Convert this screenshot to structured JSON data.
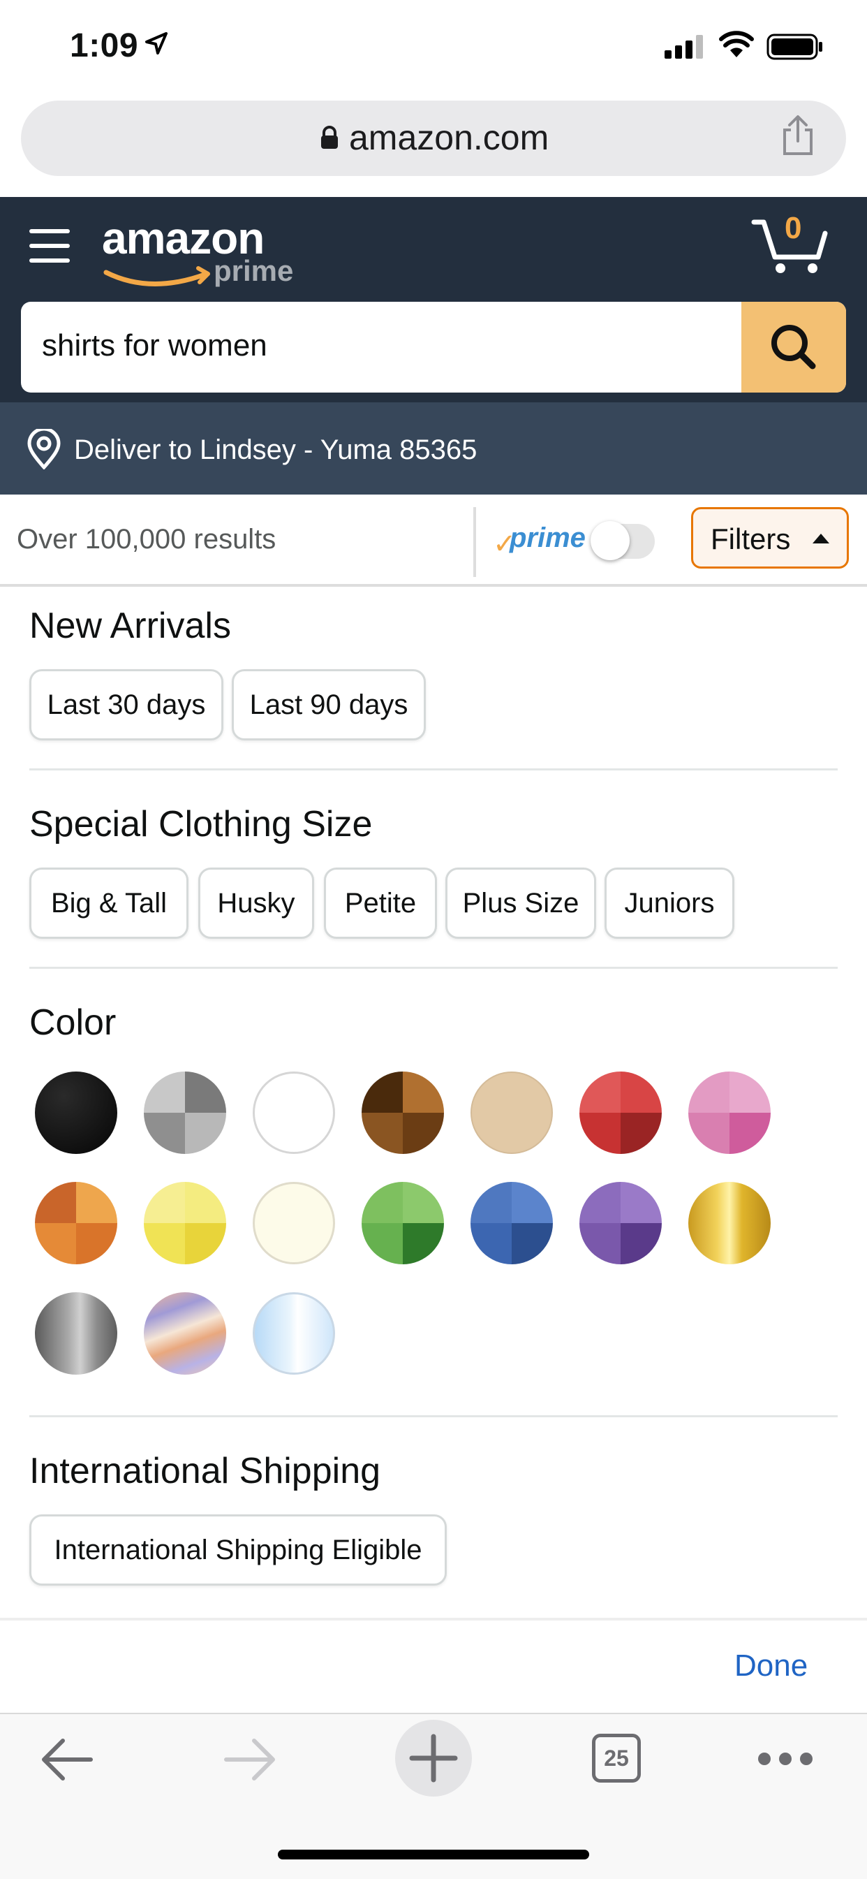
{
  "status_bar": {
    "time": "1:09"
  },
  "browser": {
    "url": "amazon.com",
    "tab_count": "25"
  },
  "header": {
    "logo_text": "amazon",
    "logo_sub": "prime",
    "cart_count": "0",
    "search_value": "shirts for women",
    "deliver_text": "Deliver to Lindsey - Yuma 85365"
  },
  "results_bar": {
    "results_text": "Over 100,000 results",
    "prime_label": "prime",
    "prime_toggle_on": false,
    "filters_label": "Filters"
  },
  "sections": {
    "new_arrivals": {
      "title": "New Arrivals",
      "options": [
        "Last 30 days",
        "Last 90 days"
      ]
    },
    "special_size": {
      "title": "Special Clothing Size",
      "options": [
        "Big & Tall",
        "Husky",
        "Petite",
        "Plus Size",
        "Juniors"
      ]
    },
    "color": {
      "title": "Color",
      "swatches": [
        {
          "name": "black",
          "hex": "#0a0a0a"
        },
        {
          "name": "gray",
          "hex": "#9a9a9a"
        },
        {
          "name": "white",
          "hex": "#ffffff"
        },
        {
          "name": "brown",
          "hex": "#8a5522"
        },
        {
          "name": "beige",
          "hex": "#e2c9a6"
        },
        {
          "name": "red",
          "hex": "#c73232"
        },
        {
          "name": "pink",
          "hex": "#d97fb0"
        },
        {
          "name": "orange",
          "hex": "#e58a37"
        },
        {
          "name": "yellow",
          "hex": "#f0e355"
        },
        {
          "name": "off-white",
          "hex": "#fdfbe9"
        },
        {
          "name": "green",
          "hex": "#66b14f"
        },
        {
          "name": "blue",
          "hex": "#3c66b1"
        },
        {
          "name": "purple",
          "hex": "#7a58ab"
        },
        {
          "name": "gold",
          "hex": "#e0b52c"
        },
        {
          "name": "silver",
          "hex": "#8c8c8c"
        },
        {
          "name": "multi",
          "hex": "#e9b5a0"
        },
        {
          "name": "clear",
          "hex": "#d6ebfb"
        }
      ]
    },
    "intl_shipping": {
      "title": "International Shipping",
      "options": [
        "International Shipping Eligible"
      ]
    }
  },
  "done_label": "Done",
  "colors": {
    "header": "#232f3e",
    "deliver_bar": "#37475a",
    "accent": "#f3a847",
    "link": "#1f64c4"
  }
}
